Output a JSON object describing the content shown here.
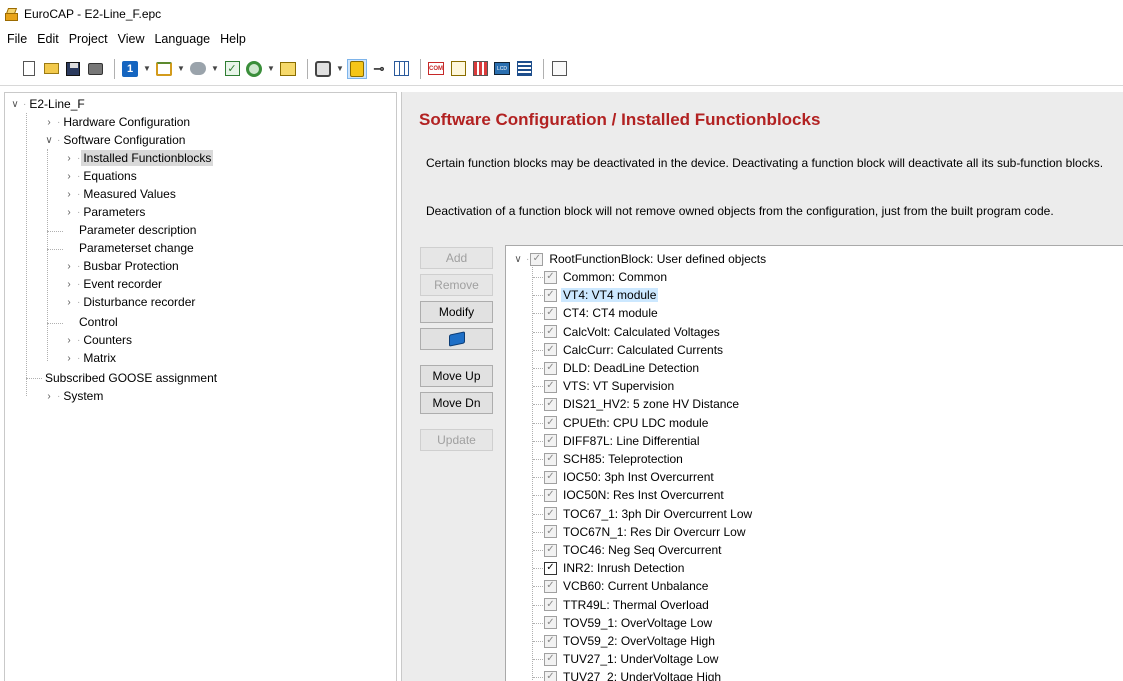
{
  "window": {
    "title": "EuroCAP - E2-Line_F.epc",
    "app_icon": "eurocap-app-icon"
  },
  "menu": [
    "File",
    "Edit",
    "Project",
    "View",
    "Language",
    "Help"
  ],
  "toolbar": {
    "icons": [
      "new-document-icon",
      "open-folder-icon",
      "save-icon",
      "print-icon",
      "device-one-icon",
      "network-icon",
      "gray-device-icon",
      "check-config-icon",
      "gear-icon",
      "tree-icon",
      "inspect-icon",
      "lock-icon",
      "key-icon",
      "grid-icon",
      "com-icon",
      "edit-icon",
      "columns-icon",
      "lcd-icon",
      "list-icon",
      "properties-icon"
    ]
  },
  "tree": {
    "root": "E2-Line_F",
    "hardware": "Hardware Configuration",
    "software": "Software Configuration",
    "installed_fb": "Installed Functionblocks",
    "equations": "Equations",
    "measured": "Measured Values",
    "parameters": "Parameters",
    "param_desc": "Parameter description",
    "paramset": "Parameterset change",
    "busbar": "Busbar Protection",
    "event": "Event recorder",
    "disturbance": "Disturbance recorder",
    "control": "Control",
    "counters": "Counters",
    "matrix": "Matrix",
    "goose": "Subscribed GOOSE assignment",
    "system": "System"
  },
  "main": {
    "title": "Software Configuration / Installed Functionblocks",
    "desc1": "Certain function blocks may be deactivated in the device. Deactivating a function block will deactivate all its sub-function blocks.",
    "desc2": "Deactivation of a function block will not remove owned objects from the configuration, just from the built program code."
  },
  "buttons": {
    "add": "Add",
    "remove": "Remove",
    "modify": "Modify",
    "move_up": "Move Up",
    "move_dn": "Move Dn",
    "update": "Update"
  },
  "function_blocks": {
    "root": "RootFunctionBlock: User defined objects",
    "items": [
      "Common: Common",
      "VT4: VT4 module",
      "CT4: CT4 module",
      "CalcVolt: Calculated Voltages",
      "CalcCurr: Calculated Currents",
      "DLD: DeadLine Detection",
      "VTS: VT Supervision",
      "DIS21_HV2: 5 zone HV Distance",
      "CPUEth: CPU LDC module",
      "DIFF87L: Line Differential",
      "SCH85: Teleprotection",
      "IOC50: 3ph Inst Overcurrent",
      "IOC50N: Res Inst Overcurrent",
      "TOC67_1: 3ph Dir Overcurrent Low",
      "TOC67N_1: Res Dir Overcurr Low",
      "TOC46: Neg Seq Overcurrent",
      "INR2: Inrush Detection",
      "VCB60: Current Unbalance",
      "TTR49L: Thermal Overload",
      "TOV59_1: OverVoltage Low",
      "TOV59_2: OverVoltage High",
      "TUV27_1: UnderVoltage Low",
      "TUV27_2: UnderVoltage High"
    ]
  }
}
